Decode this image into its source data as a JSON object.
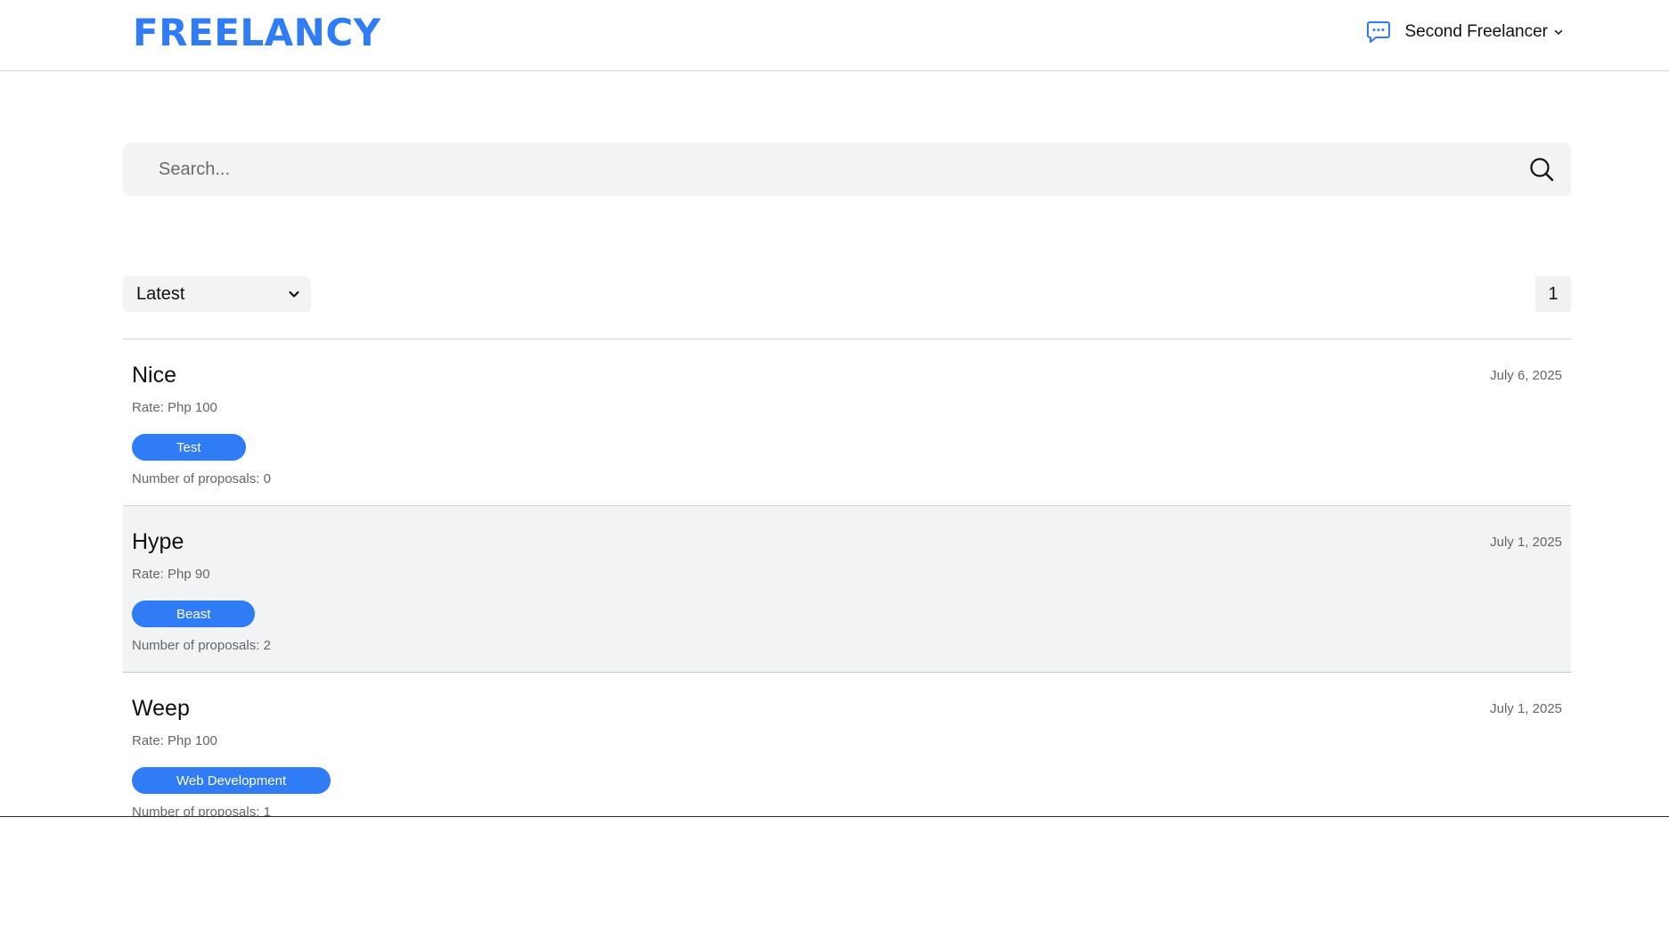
{
  "colors": {
    "brand": "#2f7cf6",
    "tag_bg": "#2f7cf6",
    "panel_bg": "#f2f3f5",
    "muted_text": "#666666"
  },
  "header": {
    "logo": "FREELANCY",
    "chat_icon": "chat-bubble-icon",
    "user_name": "Second Freelancer",
    "user_menu_icon": "chevron-down-icon"
  },
  "search": {
    "placeholder": "Search...",
    "value": "",
    "icon": "search-icon"
  },
  "controls": {
    "sort_selected": "Latest",
    "page_number": "1"
  },
  "jobs": [
    {
      "title": "Nice",
      "date": "July 6, 2025",
      "rate": "Rate: Php 100",
      "tag": "Test",
      "proposals": "Number of proposals: 0"
    },
    {
      "title": "Hype",
      "date": "July 1, 2025",
      "rate": "Rate: Php 90",
      "tag": "Beast",
      "proposals": "Number of proposals: 2"
    },
    {
      "title": "Weep",
      "date": "July 1, 2025",
      "rate": "Rate: Php 100",
      "tag": "Web Development",
      "proposals": "Number of proposals: 1"
    }
  ]
}
